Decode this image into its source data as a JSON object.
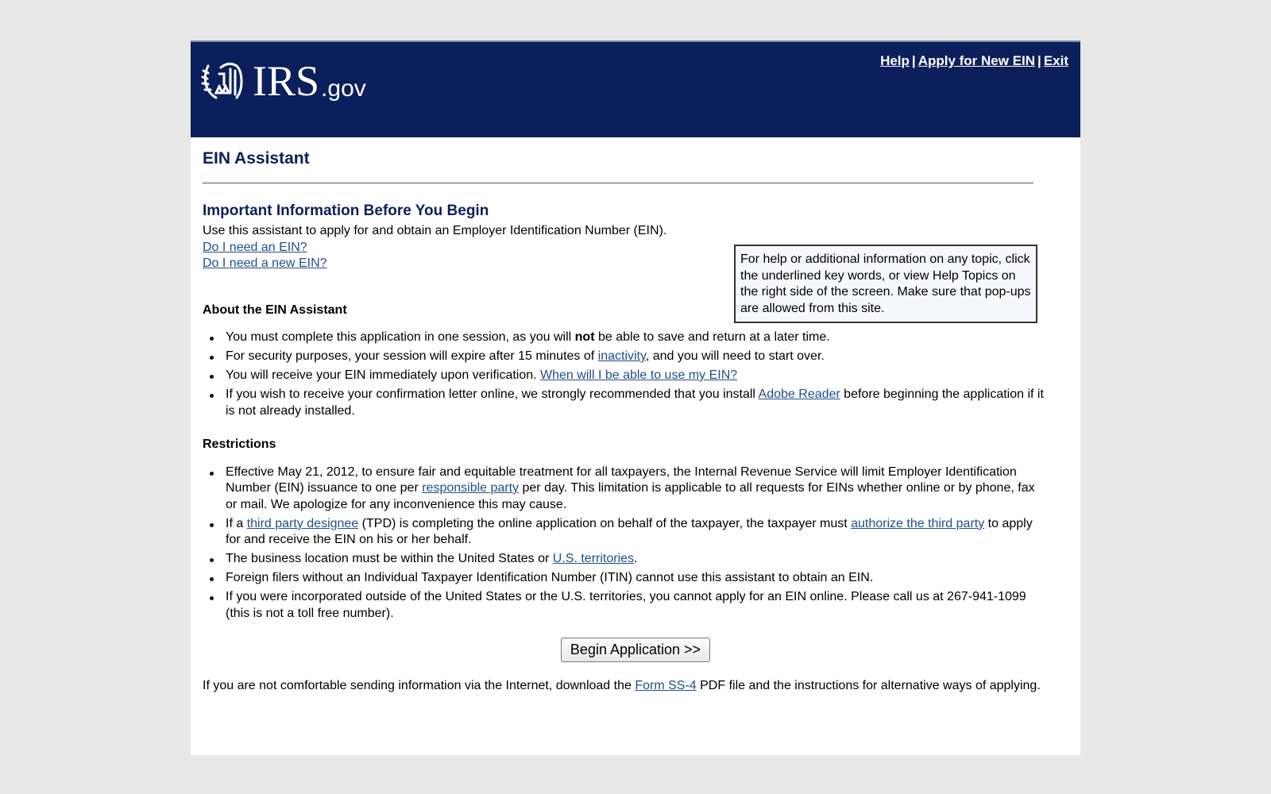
{
  "header": {
    "logo_main": "IRS",
    "logo_suffix": ".gov",
    "links": [
      "Help",
      "Apply for New EIN",
      "Exit"
    ],
    "separator": "|",
    "colors": {
      "banner": "#0b1f5c",
      "text": "#ffffff"
    }
  },
  "page": {
    "title": "EIN Assistant",
    "subtitle": "Important Information Before You Begin",
    "intro": "Use this assistant to apply for and obtain an Employer Identification Number (EIN).",
    "intro_links": [
      "Do I need an EIN?",
      "Do I need a new EIN?"
    ],
    "help_box": "For help or additional information on any topic, click the underlined key words, or view Help Topics on the right side of the screen. Make sure that pop-ups are allowed from this site."
  },
  "about": {
    "heading": "About the EIN Assistant",
    "items": [
      {
        "pre": "You must complete this application in one session, as you will ",
        "bold": "not",
        "post": " be able to save and return at a later time."
      },
      {
        "pre": "For security purposes, your session will expire after 15 minutes of ",
        "link": "inactivity",
        "post": ", and you will need to start over."
      },
      {
        "pre": "You will receive your EIN immediately upon verification. ",
        "link": "When will I be able to use my EIN?",
        "post": ""
      },
      {
        "pre": "If you wish to receive your confirmation letter online, we strongly recommended that you install ",
        "link": "Adobe Reader",
        "post": " before beginning the application if it is not already installed."
      }
    ]
  },
  "restrictions": {
    "heading": "Restrictions",
    "items": [
      {
        "pre": "Effective May 21, 2012, to ensure fair and equitable treatment for all taxpayers, the Internal Revenue Service will limit Employer Identification Number (EIN) issuance to one per ",
        "link": "responsible party",
        "post": " per day. This limitation is applicable to all requests for EINs whether online or by phone, fax or mail.  We apologize for any inconvenience this may cause."
      },
      {
        "pre": "If a ",
        "link": "third party designee",
        "mid": " (TPD) is completing the online application on behalf of the taxpayer, the taxpayer must ",
        "link2": "authorize the third party",
        "post": " to apply for and receive the EIN on his or her behalf."
      },
      {
        "pre": "The business location must be within the United States or ",
        "link": "U.S. territories",
        "post": "."
      },
      {
        "pre": "Foreign filers without an Individual Taxpayer Identification Number (ITIN) cannot use this assistant to obtain an EIN."
      },
      {
        "pre": "If you were incorporated outside of the United States or the U.S. territories, you cannot apply for an EIN online. Please call us at 267-941-1099 (this is not a toll free number)."
      }
    ]
  },
  "actions": {
    "begin_label": "Begin Application >>"
  },
  "footer": {
    "pre": "If you are not comfortable sending information via the Internet, download the ",
    "link": "Form SS-4",
    "post": " PDF file and the instructions for alternative ways of applying."
  },
  "icons": {
    "logo": "irs-eagle-icon",
    "bullet": "bullet-dot-icon"
  }
}
